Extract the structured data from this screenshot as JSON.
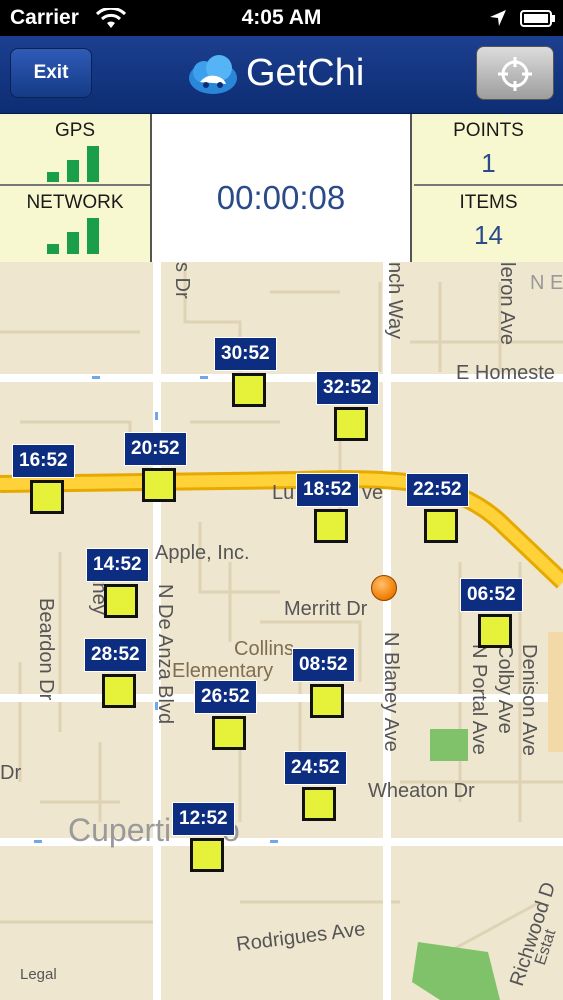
{
  "status_bar": {
    "carrier": "Carrier",
    "time": "4:05 AM",
    "icons": [
      "wifi-icon",
      "location-arrow-icon",
      "battery-icon"
    ]
  },
  "nav": {
    "exit_label": "Exit",
    "title": "GetChi",
    "logo_icon": "cloud-logo-icon",
    "locate_icon": "crosshair-icon"
  },
  "stats": {
    "gps_label": "GPS",
    "network_label": "NETWORK",
    "timer": "00:00:08",
    "points_label": "POINTS",
    "points_value": "1",
    "items_label": "ITEMS",
    "items_value": "14",
    "signal_color": "#1a9e4a"
  },
  "map": {
    "streets": {
      "homestead": "E Homeste",
      "lucille": "Lu",
      "lucille_end": "ve",
      "apple": "Apple, Inc.",
      "merritt": "Merritt Dr",
      "collins": "Collins",
      "elementary": "Elementary",
      "wheaton": "Wheaton Dr",
      "rodrigues": "Rodrigues Ave",
      "cupertino": "Cuperti",
      "cupertino_end": "o",
      "dr_left": "Dr",
      "beardon": "Beardon Dr",
      "de_anza": "N De Anza Blvd",
      "blaney": "N Blaney Ave",
      "portal": "N Portal Ave",
      "colby": "Colby Ave",
      "denison": "Denison Ave",
      "finch": "nch Way",
      "heron": "leron Ave",
      "top_dr": "s Dr",
      "ne": "N E",
      "richwood": "Richwood D",
      "estates": "Estat",
      "stelling_fragment": "tney"
    },
    "markers": [
      {
        "label": "30:52"
      },
      {
        "label": "32:52"
      },
      {
        "label": "16:52"
      },
      {
        "label": "20:52"
      },
      {
        "label": "18:52"
      },
      {
        "label": "22:52"
      },
      {
        "label": "14:52"
      },
      {
        "label": "06:52"
      },
      {
        "label": "28:52"
      },
      {
        "label": "08:52"
      },
      {
        "label": "26:52"
      },
      {
        "label": "24:52"
      },
      {
        "label": "12:52"
      }
    ],
    "legal": "Legal"
  }
}
